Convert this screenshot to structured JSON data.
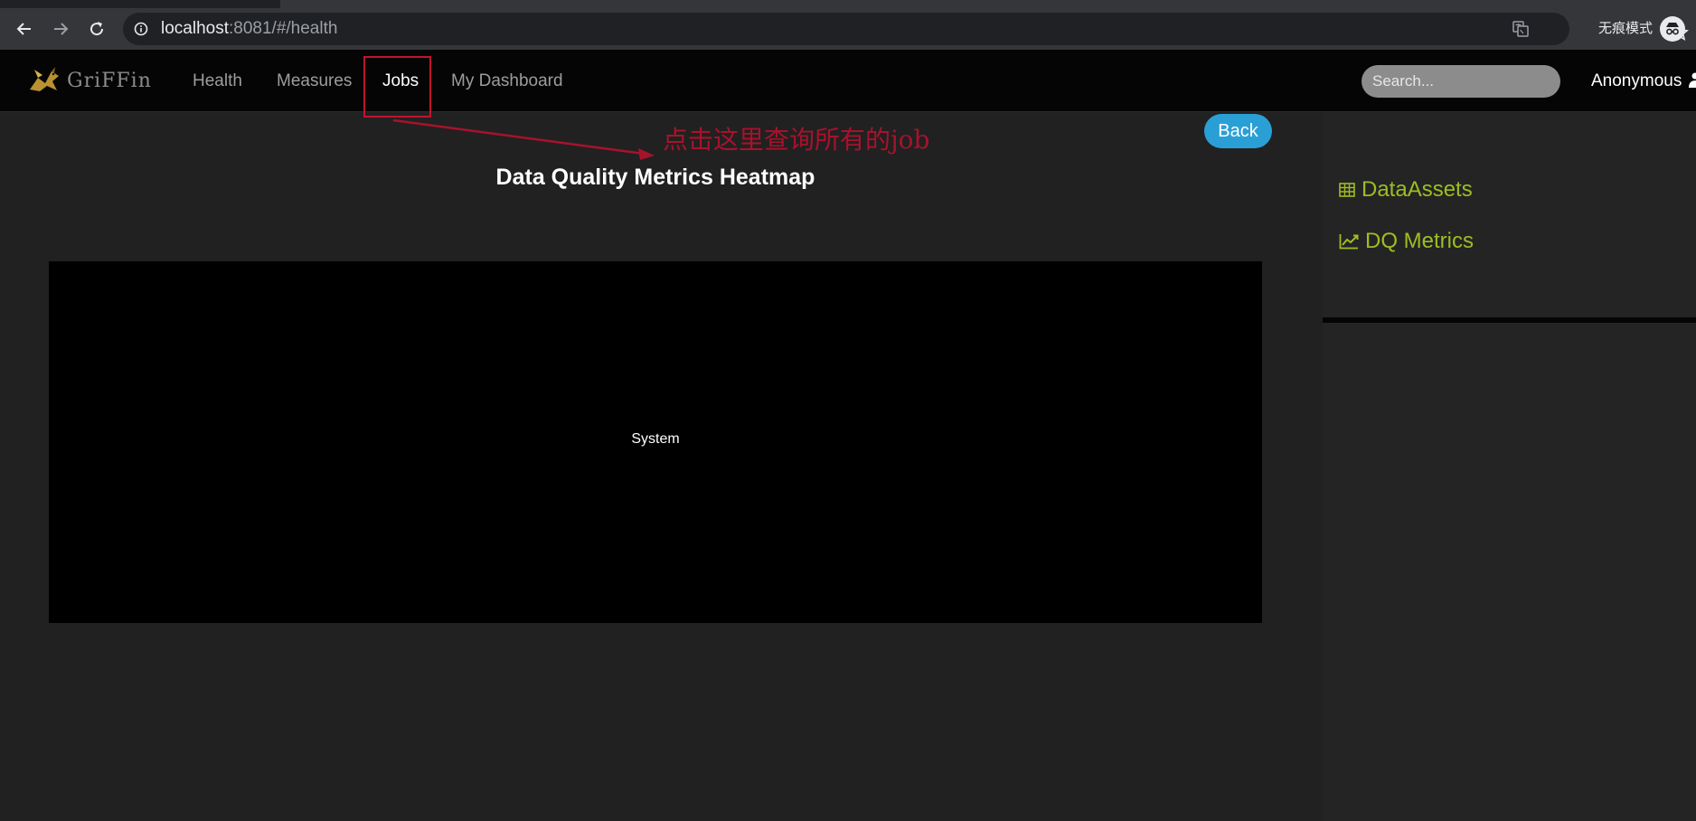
{
  "browser": {
    "url_host": "localhost",
    "url_rest": ":8081/#/health",
    "incognito_label": "无痕模式",
    "icons": {
      "back": "arrow-left-icon",
      "forward": "arrow-right-icon",
      "reload": "reload-icon",
      "info": "info-icon",
      "translate": "translate-icon",
      "bookmark": "star-icon",
      "incognito": "incognito-icon"
    }
  },
  "navbar": {
    "brand": "GriFFin",
    "links": [
      {
        "label": "Health",
        "active": false
      },
      {
        "label": "Measures",
        "active": false
      },
      {
        "label": "Jobs",
        "active": true
      },
      {
        "label": "My Dashboard",
        "active": false
      }
    ],
    "search_placeholder": "Search...",
    "user": "Anonymous"
  },
  "annotation": {
    "text": "点击这里查询所有的job",
    "color": "#a8122c"
  },
  "main": {
    "back_label": "Back",
    "title": "Data Quality Metrics Heatmap",
    "heatmap_cells": [
      {
        "label": "System"
      }
    ]
  },
  "sidebar": {
    "items": [
      {
        "label": "DataAssets",
        "icon": "table-icon"
      },
      {
        "label": "DQ Metrics",
        "icon": "line-chart-icon"
      }
    ],
    "accent": "#9ebd22"
  },
  "colors": {
    "background": "#212121",
    "navbar": "#050505",
    "back_button": "#2a9fd6"
  }
}
